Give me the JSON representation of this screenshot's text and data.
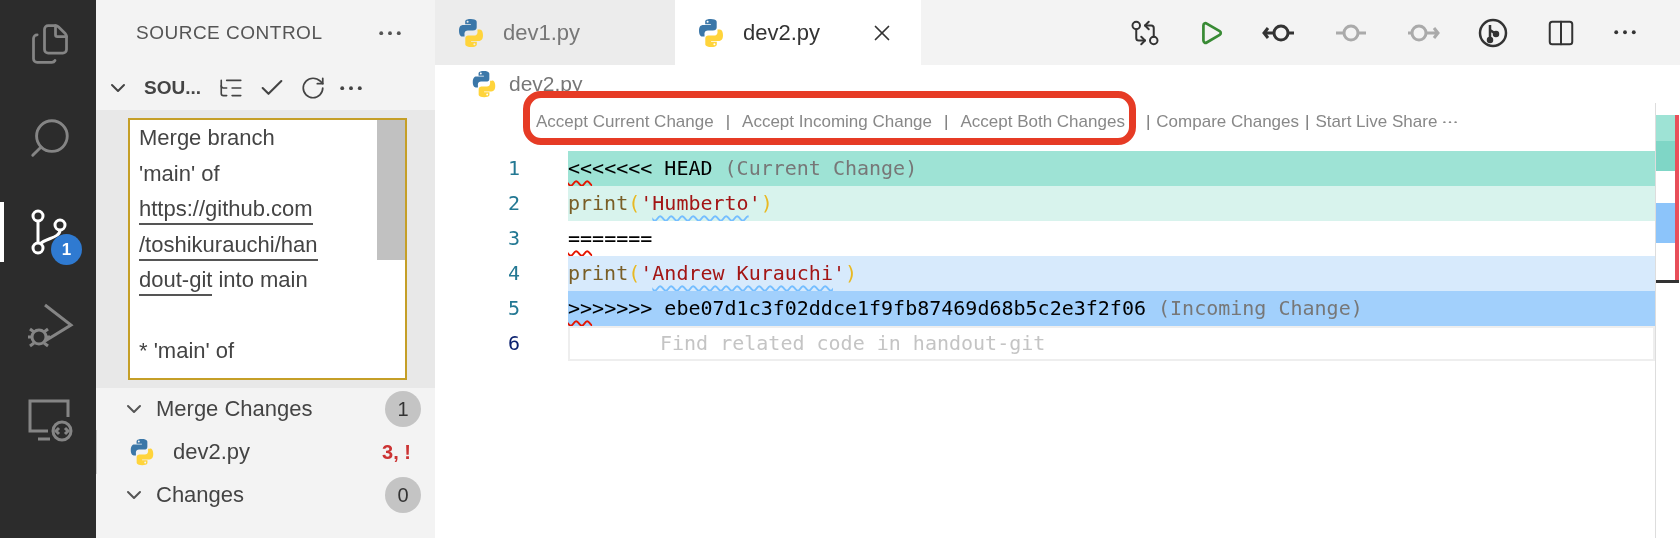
{
  "activity_bar": {
    "items": [
      {
        "kind": "files",
        "selected": false
      },
      {
        "kind": "search",
        "selected": false
      },
      {
        "kind": "scm",
        "selected": true,
        "badge": "1"
      },
      {
        "kind": "debug",
        "selected": false
      },
      {
        "kind": "remote",
        "selected": false
      }
    ]
  },
  "sidebar": {
    "title": "SOURCE CONTROL",
    "section": {
      "title": "SOU...",
      "expanded": true
    },
    "commit_message": {
      "lines": [
        {
          "blank_line_before": false,
          "segments": [
            {
              "text": "Merge branch",
              "link": false
            }
          ]
        },
        {
          "blank_line_before": false,
          "segments": [
            {
              "text": "'main' of",
              "link": false
            }
          ]
        },
        {
          "blank_line_before": false,
          "segments": [
            {
              "text": "https://github.com",
              "link": true
            }
          ]
        },
        {
          "blank_line_before": false,
          "segments": [
            {
              "text": "/toshikurauchi/han",
              "link": true
            }
          ]
        },
        {
          "blank_line_before": false,
          "segments": [
            {
              "text": "dout-git",
              "link": true
            },
            {
              "text": "into main",
              "link": false
            }
          ]
        },
        {
          "blank_line_before": true,
          "segments": [
            {
              "text": "* 'main' of",
              "link": false
            }
          ]
        }
      ]
    },
    "groups": [
      {
        "label": "Merge Changes",
        "count": "1",
        "expanded": true,
        "files": [
          {
            "name": "dev2.py",
            "status": "3, !"
          }
        ]
      },
      {
        "label": "Changes",
        "count": "0",
        "expanded": true
      }
    ]
  },
  "tabs": [
    {
      "label": "dev1.py",
      "selected": false
    },
    {
      "label": "dev2.py",
      "selected": true
    }
  ],
  "toolbar": [
    {
      "kind": "compare",
      "disabled": false
    },
    {
      "kind": "run",
      "disabled": false
    },
    {
      "kind": "previous",
      "disabled": false
    },
    {
      "kind": "commit",
      "disabled": true
    },
    {
      "kind": "next",
      "disabled": true
    },
    {
      "kind": "graph",
      "disabled": false
    },
    {
      "kind": "split",
      "disabled": false
    },
    {
      "kind": "more",
      "disabled": false
    }
  ],
  "breadcrumb": "dev2.py",
  "codelens": {
    "separator": "|",
    "actions": [
      {
        "label": "Accept Current Change",
        "highlighted": true
      },
      {
        "label": "Accept Incoming Change",
        "highlighted": true
      },
      {
        "label": "Accept Both Changes",
        "highlighted": true
      },
      {
        "label": "Compare Changes",
        "highlighted": false
      },
      {
        "label": "Start Live Share",
        "highlighted": false
      }
    ]
  },
  "lines": [
    {
      "number": "1",
      "kind": "current-header",
      "current": false,
      "tokens": [
        {
          "text": "<<",
          "kind": "plain",
          "squiggly": true
        },
        {
          "text": "<<<<< HEAD ",
          "kind": "plain",
          "squiggly": false
        },
        {
          "text": "(Current Change)",
          "kind": "comment",
          "squiggly": false
        }
      ]
    },
    {
      "number": "2",
      "kind": "current",
      "current": false,
      "tokens": [
        {
          "text": "print",
          "kind": "func",
          "squiggly": false
        },
        {
          "text": "(",
          "kind": "paren",
          "squiggly": false
        },
        {
          "text": "'",
          "kind": "string",
          "squiggly": false
        },
        {
          "text": "Humberto",
          "kind": "string",
          "squiggly": true
        },
        {
          "text": "'",
          "kind": "string",
          "squiggly": false
        },
        {
          "text": ")",
          "kind": "paren",
          "squiggly": false
        }
      ]
    },
    {
      "number": "3",
      "kind": "separator",
      "current": false,
      "tokens": [
        {
          "text": "==",
          "kind": "plain",
          "squiggly": true
        },
        {
          "text": "=====",
          "kind": "plain",
          "squiggly": false
        }
      ]
    },
    {
      "number": "4",
      "kind": "incoming",
      "current": false,
      "tokens": [
        {
          "text": "print",
          "kind": "func",
          "squiggly": false
        },
        {
          "text": "(",
          "kind": "paren",
          "squiggly": false
        },
        {
          "text": "'",
          "kind": "string",
          "squiggly": false
        },
        {
          "text": "Andrew Kurauchi",
          "kind": "string",
          "squiggly": true
        },
        {
          "text": "'",
          "kind": "string",
          "squiggly": false
        },
        {
          "text": ")",
          "kind": "paren",
          "squiggly": false
        }
      ]
    },
    {
      "number": "5",
      "kind": "incoming-header",
      "current": false,
      "tokens": [
        {
          "text": ">>",
          "kind": "plain",
          "squiggly": true
        },
        {
          "text": ">>>>> ebe07d1c3f02ddce1f9fb87469d68b5c2e3f2f06 ",
          "kind": "plain",
          "squiggly": false
        },
        {
          "text": "(Incoming Change)",
          "kind": "comment",
          "squiggly": false
        }
      ]
    },
    {
      "number": "6",
      "kind": "hint",
      "current": true,
      "hint": "Find related code in handout-git"
    }
  ]
}
